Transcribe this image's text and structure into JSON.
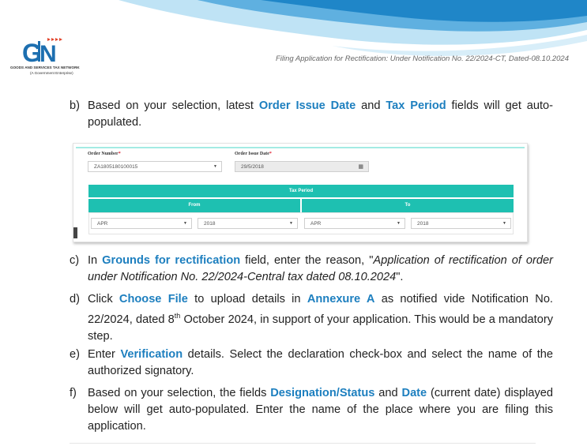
{
  "header": {
    "logo_text": "GSTN",
    "logo_line1": "GOODS AND SERVICES TAX NETWORK",
    "logo_line2": "(A Government Enterprise)",
    "title": "Filing Application for Rectification: Under Notification No. 22/2024-CT, Dated-08.10.2024"
  },
  "colors": {
    "accent_blue": "#1d7fbf",
    "teal": "#1ec0b1",
    "wave_dark": "#1f86c8",
    "wave_light": "#bfe3f5"
  },
  "steps": {
    "b": {
      "marker": "b)",
      "t1": "Based on your selection, latest ",
      "h1": "Order Issue Date",
      "t2": " and ",
      "h2": "Tax Period",
      "t3": " fields will get auto-populated."
    },
    "c": {
      "marker": "c)",
      "t1": "In ",
      "h1": "Grounds for rectification",
      "t2": " field, enter the reason, \"",
      "i1": "Application of rectification of order under Notification No. 22/2024-Central tax dated 08.10.2024",
      "t3": "\"."
    },
    "d": {
      "marker": "d)",
      "t1": "Click ",
      "h1": "Choose File",
      "t2": " to upload details in ",
      "h2": "Annexure A",
      "t3": " as notified vide Notification No. 22/2024, dated 8",
      "sup": "th",
      "t4": " October 2024, in support of your application. This would be a mandatory step."
    },
    "e": {
      "marker": "e)",
      "t1": "Enter ",
      "h1": "Verification",
      "t2": " details. Select the declaration check-box and select the name of the authorized signatory."
    },
    "f": {
      "marker": "f)",
      "t1": "Based on your selection, the fields ",
      "h1": "Designation/Status",
      "t2": " and ",
      "h2": "Date",
      "t3": " (current date) displayed below will get auto-populated. Enter the name of the place where you are filing this application."
    }
  },
  "form": {
    "order_number_label": "Order Number",
    "order_number_value": "ZA1805180100015",
    "order_date_label": "Order Issue Date",
    "order_date_value": "29/5/2018",
    "required_mark": "*",
    "tax_period_label": "Tax Period",
    "from_label": "From",
    "to_label": "To",
    "from_month": "APR",
    "from_year": "2018",
    "to_month": "APR",
    "to_year": "2018",
    "caret_icon": "chevron-down-icon",
    "calendar_icon": "calendar-icon"
  }
}
